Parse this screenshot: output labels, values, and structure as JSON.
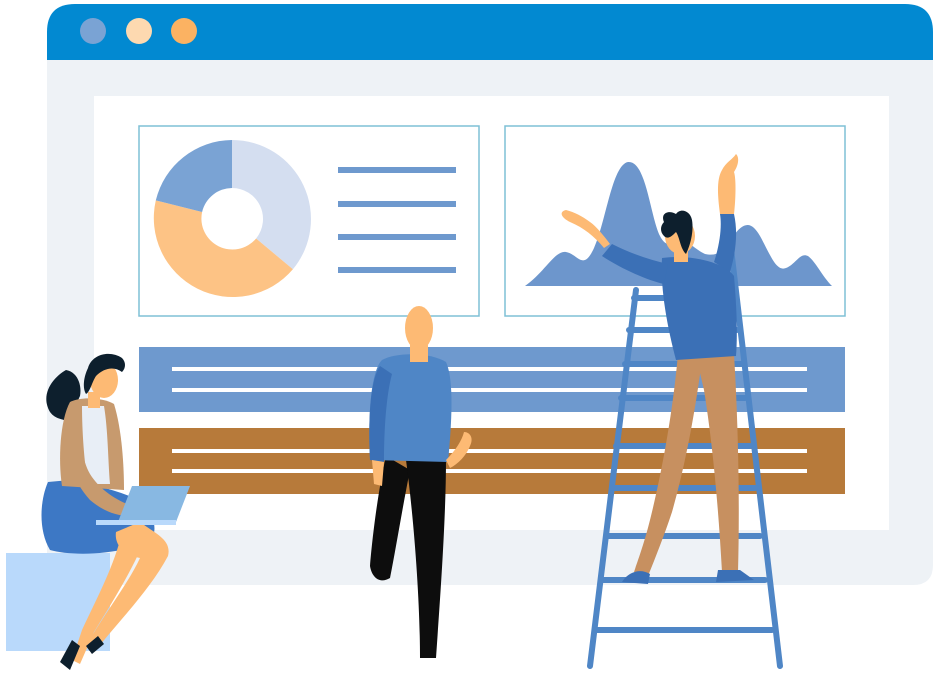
{
  "illustration": {
    "window": {
      "titlebar_color": "#0289D1",
      "frame_color": "#EEF2F6",
      "content_color": "#FFFFFF",
      "dots": [
        {
          "name": "dot-1",
          "color": "#7AA3D4"
        },
        {
          "name": "dot-2",
          "color": "#FDD9B0"
        },
        {
          "name": "dot-3",
          "color": "#FBB262"
        }
      ]
    },
    "donut_chart": {
      "slices": [
        {
          "color": "#D4DEF0",
          "fraction": 0.36
        },
        {
          "color": "#FDC385",
          "fraction": 0.44
        },
        {
          "color": "#7AA3D4",
          "fraction": 0.2
        }
      ]
    },
    "panel_colors": {
      "card_border": "#7FC0D6",
      "list_lines": "#6E99CE",
      "area_chart": "#6D96CC",
      "blue_bar": "#6E99CE",
      "brown_bar": "#B77A3A",
      "bar_lines": "#FFFFFF"
    },
    "people": [
      {
        "name": "woman-with-laptop",
        "shirt": "#7AA3D4",
        "skirt": "#3D78C5",
        "cardigan": "#C79A6E",
        "hair": "#0D1F2D"
      },
      {
        "name": "bald-man",
        "shirt": "#4F86C6",
        "pants": "#0D0D0D",
        "skin": "#FDBA74"
      },
      {
        "name": "man-on-ladder",
        "shirt": "#3B70B6",
        "pants": "#C79060",
        "hair": "#0D1F2D"
      }
    ],
    "ladder_color": "#4F86C6",
    "box_color": "#B9D9FB"
  }
}
